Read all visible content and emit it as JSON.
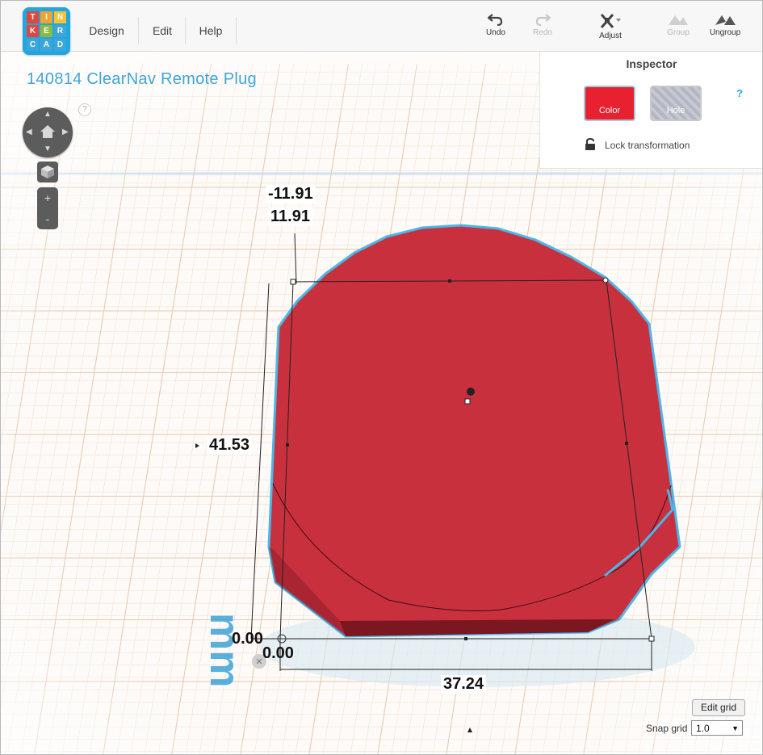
{
  "logo": {
    "letters": [
      "T",
      "I",
      "N",
      "K",
      "E",
      "R",
      "C",
      "A",
      "D"
    ]
  },
  "menu": {
    "design": "Design",
    "edit": "Edit",
    "help": "Help"
  },
  "toolbar": {
    "undo": "Undo",
    "redo": "Redo",
    "adjust": "Adjust",
    "group": "Group",
    "ungroup": "Ungroup"
  },
  "project": {
    "title": "140814 ClearNav Remote Plug"
  },
  "inspector": {
    "title": "Inspector",
    "color_label": "Color",
    "hole_label": "Hole",
    "help": "?",
    "lock_label": "Lock transformation",
    "color_hex": "#e8202f"
  },
  "nav": {
    "help": "?",
    "zoom_in": "+",
    "zoom_out": "-"
  },
  "dimensions": {
    "top_neg": "-11.91",
    "top_pos": "11.91",
    "depth": "41.53",
    "origin_y": "0.00",
    "origin_x": "0.00",
    "width": "37.24"
  },
  "units": "mm",
  "grid": {
    "edit_label": "Edit grid",
    "snap_label": "Snap grid",
    "snap_value": "1.0"
  },
  "colors": {
    "shape": "#c9303d",
    "selection": "#4cb6e8",
    "grid_minor": "#f1dccb",
    "grid_major": "#e3c3a8",
    "title": "#3ea4d6"
  }
}
